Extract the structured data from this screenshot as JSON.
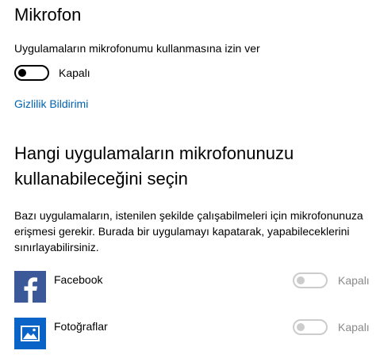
{
  "page": {
    "title": "Mikrofon"
  },
  "mic_access": {
    "label": "Uygulamaların mikrofonumu kullanmasına izin ver",
    "toggle_on": false,
    "state_label": "Kapalı"
  },
  "privacy_link": "Gizlilik Bildirimi",
  "apps_section": {
    "heading": "Hangi uygulamaların mikrofonunuzu kullanabileceğini seçin",
    "description": "Bazı uygulamaların, istenilen şekilde çalışabilmeleri için mikrofonunuza erişmesi gerekir. Burada bir uygulamayı kapatarak, yapabileceklerini sınırlayabilirsiniz.",
    "apps": [
      {
        "name": "Facebook",
        "icon": "facebook-icon",
        "toggle_on": false,
        "enabled": false,
        "state_label": "Kapalı"
      },
      {
        "name": "Fotoğraflar",
        "icon": "photos-icon",
        "toggle_on": false,
        "enabled": false,
        "state_label": "Kapalı"
      }
    ]
  },
  "colors": {
    "link": "#0063b1",
    "app_icon_bg": "#2f5a9e",
    "disabled": "#cccccc",
    "disabled_text": "#8a8a8a"
  }
}
